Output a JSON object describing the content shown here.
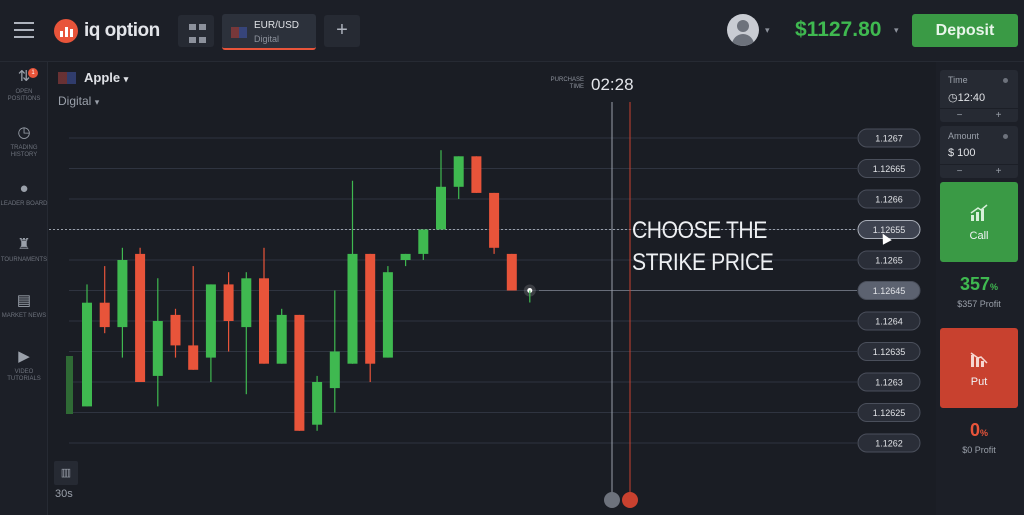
{
  "header": {
    "logo_text": "iq option",
    "asset_tab": {
      "title": "EUR/USD",
      "subtitle": "Digital"
    },
    "plus_label": "+",
    "balance": "$1127.80",
    "deposit_label": "Deposit"
  },
  "left_nav": [
    {
      "label": "Open Positions",
      "icon": "open-positions-icon",
      "badge": "1"
    },
    {
      "label": "Trading History",
      "icon": "history-icon"
    },
    {
      "label": "Leader Board",
      "icon": "leaderboard-icon"
    },
    {
      "label": "Tournaments",
      "icon": "trophy-icon"
    },
    {
      "label": "Market News",
      "icon": "news-icon"
    },
    {
      "label": "Video Tutorials",
      "icon": "play-icon"
    }
  ],
  "chart_header": {
    "asset": "Apple",
    "type": "Digital",
    "purchase_time_label": "PURCHASE TIME",
    "purchase_time": "02:28"
  },
  "overlay_text": [
    "CHOOSE THE",
    "STRIKE PRICE"
  ],
  "timeframe": "30s",
  "chart_data": {
    "type": "candlestick",
    "strike_prices": [
      "1.1267",
      "1.12665",
      "1.1266",
      "1.12655",
      "1.1265",
      "1.12645",
      "1.1264",
      "1.12635",
      "1.1263",
      "1.12625",
      "1.1262"
    ],
    "highlighted_strike": "1.12645",
    "hovered_strike": "1.12655",
    "candles": [
      {
        "o": 1.12626,
        "h": 1.12646,
        "l": 1.12626,
        "c": 1.12643,
        "dir": "up"
      },
      {
        "o": 1.12643,
        "h": 1.12649,
        "l": 1.12638,
        "c": 1.12639,
        "dir": "down"
      },
      {
        "o": 1.12639,
        "h": 1.12652,
        "l": 1.12634,
        "c": 1.1265,
        "dir": "up"
      },
      {
        "o": 1.12651,
        "h": 1.12652,
        "l": 1.1263,
        "c": 1.1263,
        "dir": "down"
      },
      {
        "o": 1.12631,
        "h": 1.12647,
        "l": 1.12626,
        "c": 1.1264,
        "dir": "up"
      },
      {
        "o": 1.12641,
        "h": 1.12642,
        "l": 1.12634,
        "c": 1.12636,
        "dir": "down"
      },
      {
        "o": 1.12636,
        "h": 1.12649,
        "l": 1.12632,
        "c": 1.12632,
        "dir": "down"
      },
      {
        "o": 1.12634,
        "h": 1.12646,
        "l": 1.1263,
        "c": 1.12646,
        "dir": "up"
      },
      {
        "o": 1.12646,
        "h": 1.12648,
        "l": 1.12635,
        "c": 1.1264,
        "dir": "down"
      },
      {
        "o": 1.12639,
        "h": 1.12648,
        "l": 1.12628,
        "c": 1.12647,
        "dir": "up"
      },
      {
        "o": 1.12647,
        "h": 1.12652,
        "l": 1.12633,
        "c": 1.12633,
        "dir": "down"
      },
      {
        "o": 1.12633,
        "h": 1.12642,
        "l": 1.12633,
        "c": 1.12641,
        "dir": "up"
      },
      {
        "o": 1.12641,
        "h": 1.12641,
        "l": 1.12622,
        "c": 1.12622,
        "dir": "down"
      },
      {
        "o": 1.12623,
        "h": 1.12631,
        "l": 1.12622,
        "c": 1.1263,
        "dir": "up"
      },
      {
        "o": 1.12629,
        "h": 1.12645,
        "l": 1.12625,
        "c": 1.12635,
        "dir": "up"
      },
      {
        "o": 1.12633,
        "h": 1.12663,
        "l": 1.12633,
        "c": 1.12651,
        "dir": "up"
      },
      {
        "o": 1.12651,
        "h": 1.12651,
        "l": 1.1263,
        "c": 1.12633,
        "dir": "down"
      },
      {
        "o": 1.12634,
        "h": 1.12649,
        "l": 1.12634,
        "c": 1.12648,
        "dir": "up"
      },
      {
        "o": 1.1265,
        "h": 1.12651,
        "l": 1.12649,
        "c": 1.12651,
        "dir": "up"
      },
      {
        "o": 1.12651,
        "h": 1.12655,
        "l": 1.1265,
        "c": 1.12655,
        "dir": "up"
      },
      {
        "o": 1.12655,
        "h": 1.12668,
        "l": 1.12655,
        "c": 1.12662,
        "dir": "up"
      },
      {
        "o": 1.12662,
        "h": 1.12667,
        "l": 1.1266,
        "c": 1.12667,
        "dir": "up"
      },
      {
        "o": 1.12667,
        "h": 1.12667,
        "l": 1.12661,
        "c": 1.12661,
        "dir": "down"
      },
      {
        "o": 1.12661,
        "h": 1.12661,
        "l": 1.12651,
        "c": 1.12652,
        "dir": "down"
      },
      {
        "o": 1.12651,
        "h": 1.12651,
        "l": 1.12645,
        "c": 1.12645,
        "dir": "down"
      }
    ],
    "current_price": 1.12645,
    "colors": {
      "up": "#3fb950",
      "down": "#e8543a"
    }
  },
  "right_panel": {
    "time_label": "Time",
    "time_value": "12:40",
    "amount_label": "Amount",
    "amount_value": "$ 100",
    "minus": "−",
    "plus": "+",
    "call_label": "Call",
    "call_pct": "357",
    "call_pct_unit": "%",
    "call_profit": "$357 Profit",
    "put_label": "Put",
    "put_pct": "0",
    "put_pct_unit": "%",
    "put_profit": "$0 Profit"
  }
}
